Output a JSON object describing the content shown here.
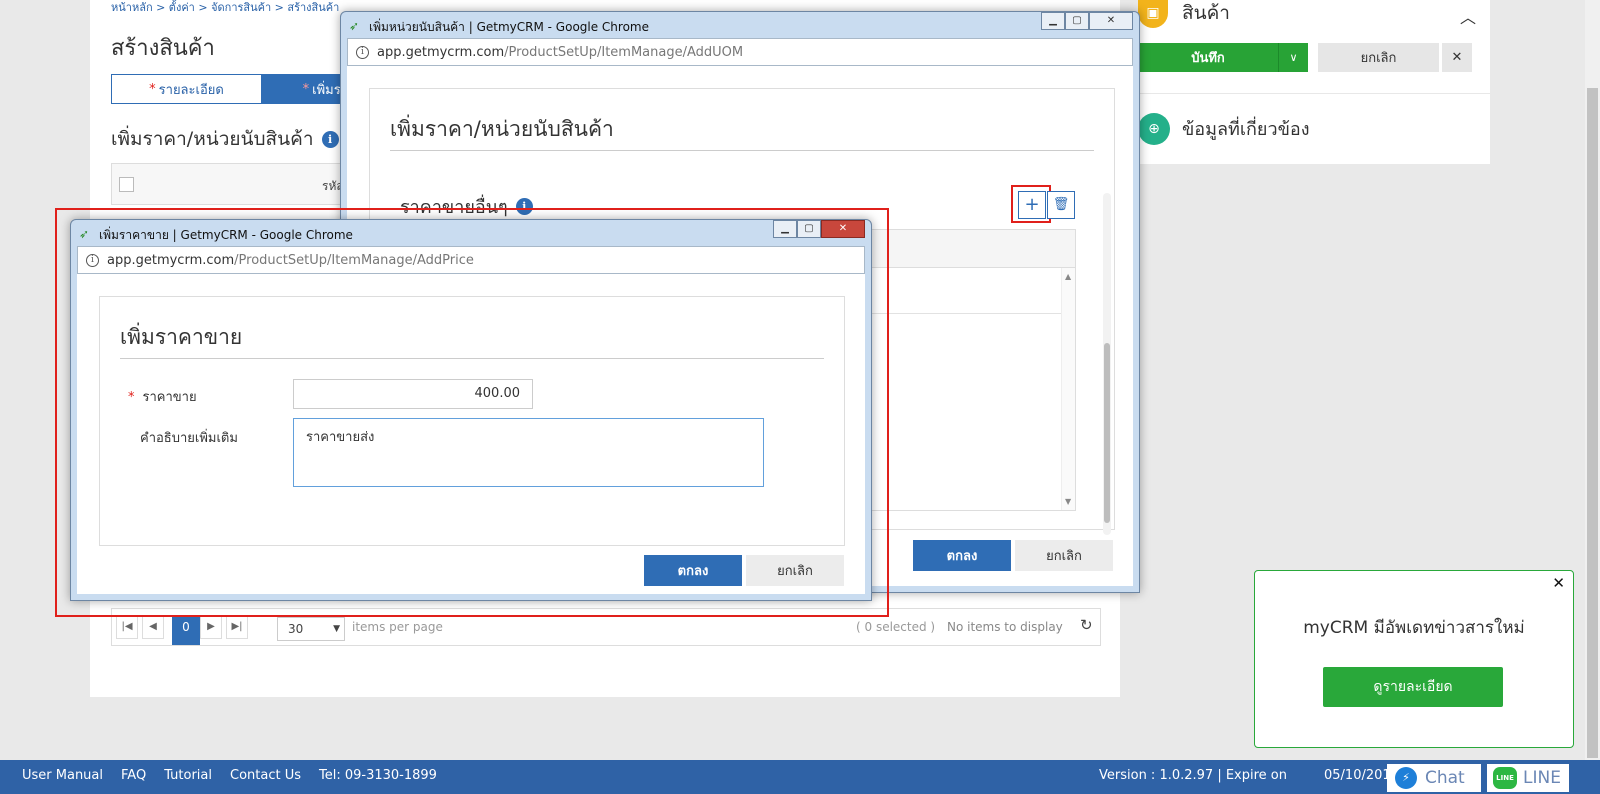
{
  "page": {
    "breadcrumb": "หน้าหลัก  >  ตั้งค่า  >  จัดการสินค้า  >  สร้างสินค้า",
    "title": "สร้างสินค้า",
    "tabs": [
      {
        "label": "รายละเอียด",
        "required": "*"
      },
      {
        "label": "เพิ่มราคา/",
        "required": "*"
      }
    ],
    "section_title": "เพิ่มราคา/หน่วยนับสินค้า",
    "grid_column": "รหัสหน่วยนับสินค้า",
    "pager": {
      "page": "0",
      "page_size": "30",
      "items_per_page": "items per page",
      "selected": "( 0 selected )",
      "empty": "No items to display"
    }
  },
  "right_panel": {
    "title": "สินค้า",
    "save": "บันทึก",
    "cancel": "ยกเลิก",
    "related": "ข้อมูลที่เกี่ยวข้อง"
  },
  "window_uom": {
    "title": "เพิ่มหน่วยนับสินค้า | GetmyCRM - Google Chrome",
    "url_host": "app.getmycrm.com",
    "url_path": "/ProductSetUp/ItemManage/AddUOM",
    "heading": "เพิ่มราคา/หน่วยนับสินค้า",
    "subheading": "ราคาขายอื่นๆ",
    "ok": "ตกลง",
    "cancel": "ยกเลิก"
  },
  "window_price": {
    "title": "เพิ่มราคาขาย | GetmyCRM - Google Chrome",
    "url_host": "app.getmycrm.com",
    "url_path": "/ProductSetUp/ItemManage/AddPrice",
    "heading": "เพิ่มราคาขาย",
    "price_label": "ราคาขาย",
    "price_required": "*",
    "price_value": "400.00",
    "desc_label": "คำอธิบายเพิ่มเติม",
    "desc_value": "ราคาขายส่ง",
    "ok": "ตกลง",
    "cancel": "ยกเลิก"
  },
  "notification": {
    "message": "myCRM มีอัพเดทข่าวสารใหม่",
    "button": "ดูรายละเอียด"
  },
  "footer": {
    "links": [
      "User Manual",
      "FAQ",
      "Tutorial",
      "Contact Us",
      "Tel: 09-3130-1899"
    ],
    "version": "Version : 1.0.2.97 | Expire on",
    "expire_date": "05/10/2017",
    "chat": "Chat",
    "line": "LINE",
    "line_icon": "LINE"
  },
  "icons": {
    "accent": "#2f6db5",
    "green": "#28a336",
    "highlight": "#e0201b"
  }
}
